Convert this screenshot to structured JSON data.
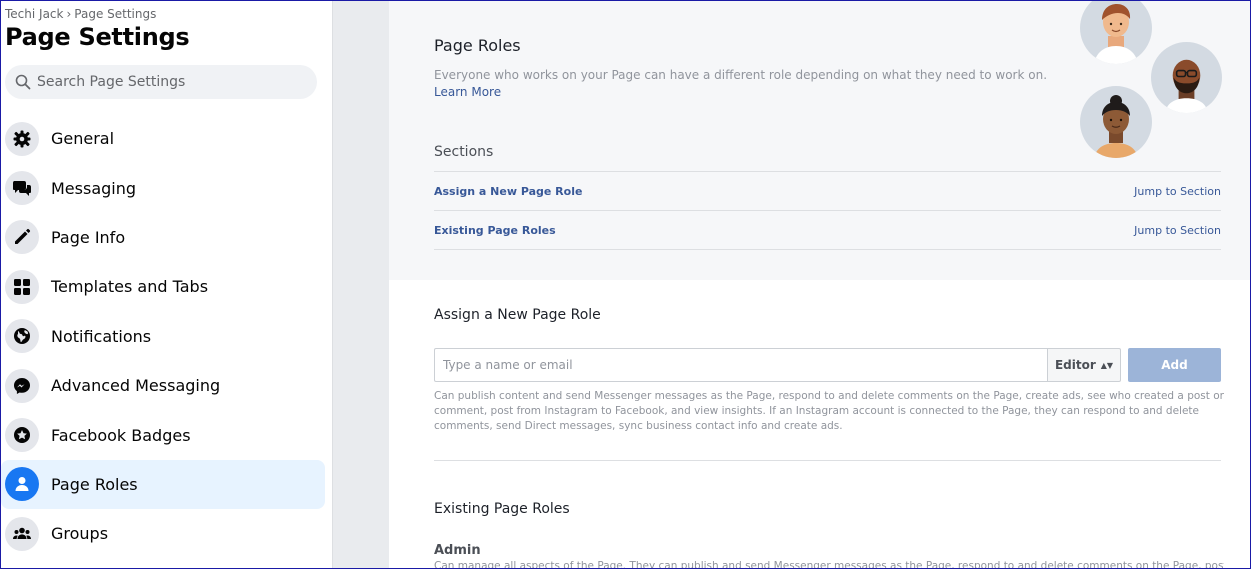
{
  "breadcrumb": {
    "parent": "Techi Jack",
    "separator": "›",
    "current": "Page Settings"
  },
  "sidebar": {
    "title": "Page Settings",
    "search_placeholder": "Search Page Settings",
    "items": [
      {
        "label": "General",
        "icon": "gear-icon"
      },
      {
        "label": "Messaging",
        "icon": "chat-bubbles-icon"
      },
      {
        "label": "Page Info",
        "icon": "pencil-icon"
      },
      {
        "label": "Templates and Tabs",
        "icon": "grid-icon"
      },
      {
        "label": "Notifications",
        "icon": "globe-icon"
      },
      {
        "label": "Advanced Messaging",
        "icon": "messenger-icon"
      },
      {
        "label": "Facebook Badges",
        "icon": "badge-star-icon"
      },
      {
        "label": "Page Roles",
        "icon": "person-icon",
        "active": true
      },
      {
        "label": "Groups",
        "icon": "group-icon"
      }
    ]
  },
  "page_roles": {
    "title": "Page Roles",
    "description": "Everyone who works on your Page can have a different role depending on what they need to work on.",
    "learn_more": "Learn More",
    "sections_label": "Sections",
    "sections": [
      {
        "name": "Assign a New Page Role",
        "jump": "Jump to Section"
      },
      {
        "name": "Existing Page Roles",
        "jump": "Jump to Section"
      }
    ]
  },
  "assign": {
    "title": "Assign a New Page Role",
    "input_placeholder": "Type a name or email",
    "role_value": "Editor",
    "add_label": "Add",
    "help_text": "Can publish content and send Messenger messages as the Page, respond to and delete comments on the Page, create ads, see who created a post or comment, post from Instagram to Facebook, and view insights. If an Instagram account is connected to the Page, they can respond to and delete comments, send Direct messages, sync business contact info and create ads."
  },
  "existing": {
    "title": "Existing Page Roles",
    "role_name": "Admin",
    "role_desc": "Can manage all aspects of the Page. They can publish and send Messenger messages as the Page, respond to and delete comments on the Page, post from"
  },
  "colors": {
    "accent": "#1877f2",
    "link": "#385898",
    "active_bg": "#e7f3ff",
    "add_button": "#9cb4d8"
  }
}
